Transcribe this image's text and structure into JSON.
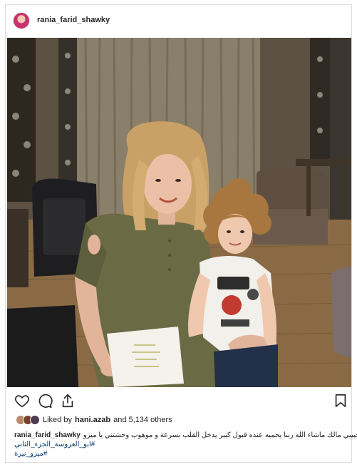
{
  "post": {
    "username": "rania_farid_shawky",
    "likes_prefix": "Liked by",
    "liked_by_user": "hani.azab",
    "likes_suffix": "and 5,134 others",
    "caption_text": "حبيبي مالك ماشاء الله ربنا يحميه عنده قبول كبير يدخل القلب بسرعة و موهوب وحشتني يا ميزو",
    "hashtags": [
      "#ابو_العروسة_الجزء_الثاني",
      "#ميزو_نيرة"
    ]
  },
  "icons": {
    "like": "heart-icon",
    "comment": "comment-icon",
    "share": "share-icon",
    "save": "bookmark-icon"
  },
  "colors": {
    "border": "#dbdbdb",
    "text": "#262626",
    "hashtag": "#00376b"
  }
}
